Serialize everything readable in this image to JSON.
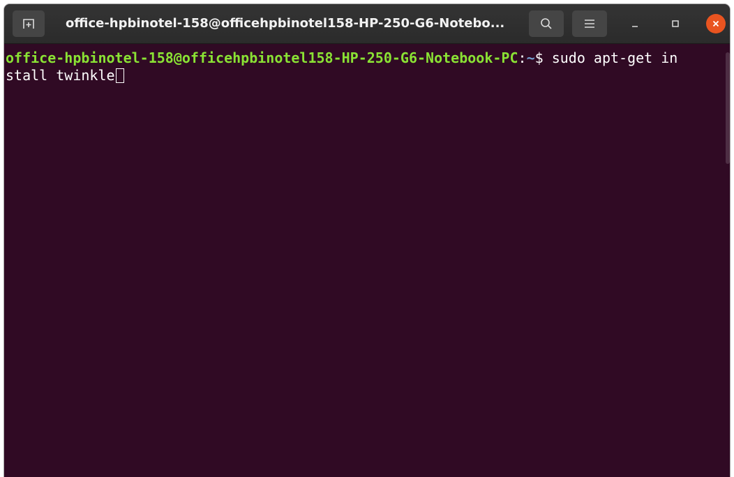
{
  "window": {
    "title": "office-hpbinotel-158@officehpbinotel158-HP-250-G6-Notebo..."
  },
  "icons": {
    "new_tab": "new-tab-icon",
    "search": "search-icon",
    "menu": "hamburger-menu-icon",
    "minimize": "minimize-icon",
    "maximize": "maximize-icon",
    "close": "close-icon"
  },
  "terminal": {
    "prompt_user_host": "office-hpbinotel-158@officehpbinotel158-HP-250-G6-Notebook-PC",
    "prompt_colon": ":",
    "prompt_path": "~",
    "prompt_symbol": "$ ",
    "command_line1": "sudo apt-get in",
    "command_line2": "stall twinkle"
  },
  "colors": {
    "terminal_bg": "#300a24",
    "user_host": "#8ae234",
    "path": "#729fcf",
    "close_button": "#e95420"
  }
}
